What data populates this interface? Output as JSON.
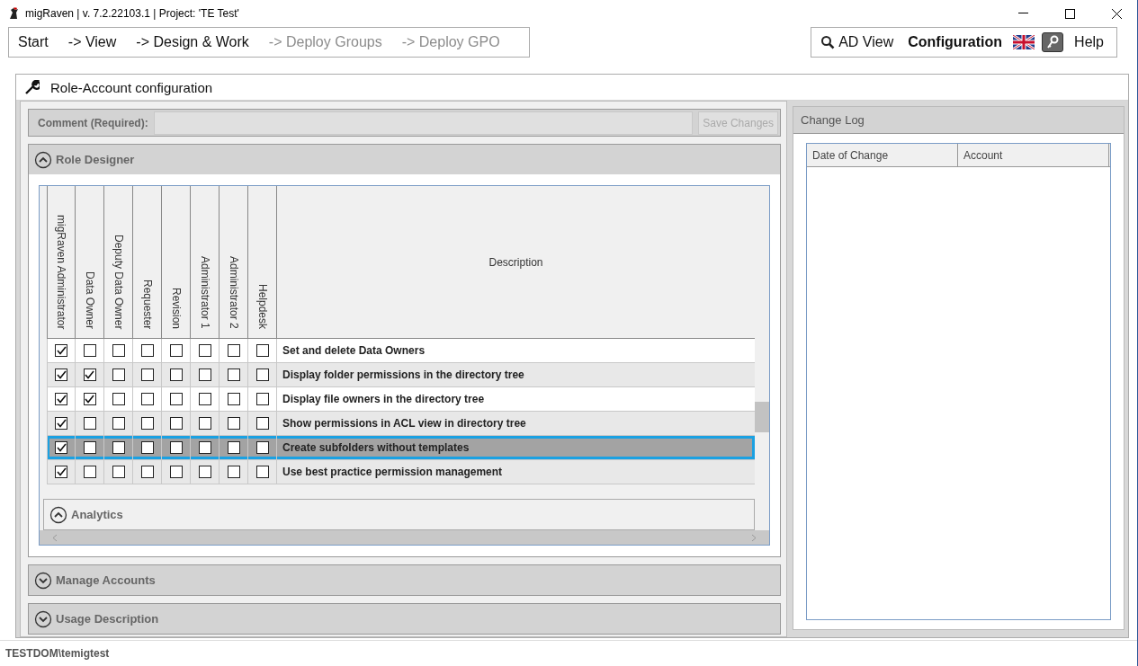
{
  "window": {
    "title": "migRaven | v. 7.2.22103.1 | Project: 'TE Test'"
  },
  "nav": [
    {
      "label": "Start",
      "disabled": false
    },
    {
      "label": "-> View",
      "disabled": false
    },
    {
      "label": "-> Design & Work",
      "disabled": false
    },
    {
      "label": "-> Deploy Groups",
      "disabled": true
    },
    {
      "label": "-> Deploy GPO",
      "disabled": true
    }
  ],
  "toolbar": {
    "ad_view": "AD View",
    "configuration": "Configuration",
    "help": "Help"
  },
  "panel": {
    "title": "Role-Account configuration"
  },
  "comment": {
    "label": "Comment (Required):",
    "save_button": "Save Changes",
    "save_disabled": true
  },
  "role_designer": {
    "title": "Role Designer",
    "expanded": true,
    "columns": [
      "migRaven Administrator",
      "Data Owner",
      "Deputy Data Owner",
      "Requester",
      "Revision",
      "Administrator 1",
      "Administrator 2",
      "Helpdesk"
    ],
    "description_header": "Description",
    "rows": [
      {
        "description": "Set and delete Data Owners",
        "selected": false,
        "checks": [
          true,
          false,
          false,
          false,
          false,
          false,
          false,
          false
        ]
      },
      {
        "description": "Display folder permissions in the directory tree",
        "selected": false,
        "checks": [
          true,
          true,
          false,
          false,
          false,
          false,
          false,
          false
        ]
      },
      {
        "description": "Display file owners in the directory tree",
        "selected": false,
        "checks": [
          true,
          true,
          false,
          false,
          false,
          false,
          false,
          false
        ]
      },
      {
        "description": "Show permissions in ACL view in directory tree",
        "selected": false,
        "checks": [
          true,
          false,
          false,
          false,
          false,
          false,
          false,
          false
        ]
      },
      {
        "description": "Create subfolders without templates",
        "selected": true,
        "checks": [
          true,
          false,
          false,
          false,
          false,
          false,
          false,
          false
        ]
      },
      {
        "description": "Use best practice permission management",
        "selected": false,
        "checks": [
          true,
          false,
          false,
          false,
          false,
          false,
          false,
          false
        ]
      }
    ],
    "subsections": [
      {
        "title": "Analytics",
        "expanded": true
      }
    ]
  },
  "sections": [
    {
      "title": "Manage Accounts",
      "expanded": false
    },
    {
      "title": "Usage Description",
      "expanded": false
    }
  ],
  "change_log": {
    "title": "Change Log",
    "columns": [
      "Date of Change",
      "Account"
    ]
  },
  "status_bar": {
    "user": "TESTDOM\\temigtest"
  }
}
